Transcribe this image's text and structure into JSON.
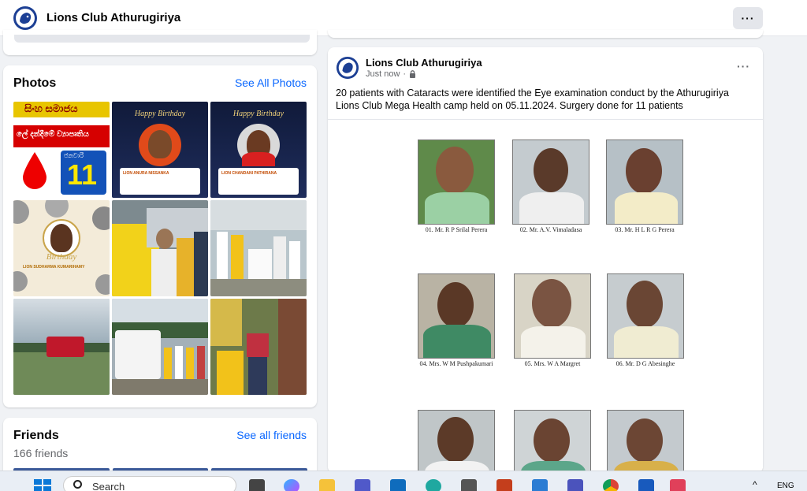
{
  "header": {
    "title": "Lions Club Athurugiriya",
    "more_label": "···"
  },
  "photos": {
    "heading": "Photos",
    "see_all": "See All Photos",
    "tiles": [
      {
        "kind": "poster",
        "lines": [
          "සිංහ සමාජය",
          "ලේ දන්දීමේ ව්‍යාපෘතිය",
          "ජනවාරි",
          "11"
        ]
      },
      {
        "kind": "birthday",
        "heading": "Happy Birthday",
        "name": "LION ANURA NISSANKA"
      },
      {
        "kind": "birthday",
        "heading": "Happy Birthday",
        "name": "LION CHANDANI PATHIRANA"
      },
      {
        "kind": "birthday2",
        "heading": "Birthday",
        "name": "LION SUDHARMA KUMARIHAMY"
      },
      {
        "kind": "photo",
        "scene": "lions members meeting"
      },
      {
        "kind": "photo",
        "scene": "health camp hall"
      },
      {
        "kind": "photo",
        "scene": "blood bank bus"
      },
      {
        "kind": "photo",
        "scene": "mobile bus group"
      },
      {
        "kind": "photo",
        "scene": "outdoor greeting"
      }
    ]
  },
  "friends": {
    "heading": "Friends",
    "count": "166 friends",
    "see_all": "See all friends"
  },
  "post": {
    "author": "Lions Club Athurugiriya",
    "time": "Just now",
    "more_label": "···",
    "text": "20 patients with Cataracts were identified the Eye examination conduct by the Athurugiriya Lions Club Mega Health camp held on 05.11.2024. Surgery done for 11 patients",
    "patients": [
      {
        "caption": "01. Mr. R P Srilal Perera"
      },
      {
        "caption": "02. Mr. A.V. Vimaladasa"
      },
      {
        "caption": "03. Mr. H L R G Perera"
      },
      {
        "caption": "04. Mrs. W M Pushpakumari"
      },
      {
        "caption": "05. Mrs. W A Margret"
      },
      {
        "caption": "06. Mr. D G Abesinghe"
      },
      {
        "caption": ""
      },
      {
        "caption": ""
      },
      {
        "caption": ""
      }
    ]
  },
  "taskbar": {
    "search_placeholder": "Search",
    "lang": "ENG"
  },
  "colors": {
    "accent": "#0866ff",
    "bg": "#f0f2f5",
    "card": "#ffffff",
    "muted": "#65676b"
  }
}
